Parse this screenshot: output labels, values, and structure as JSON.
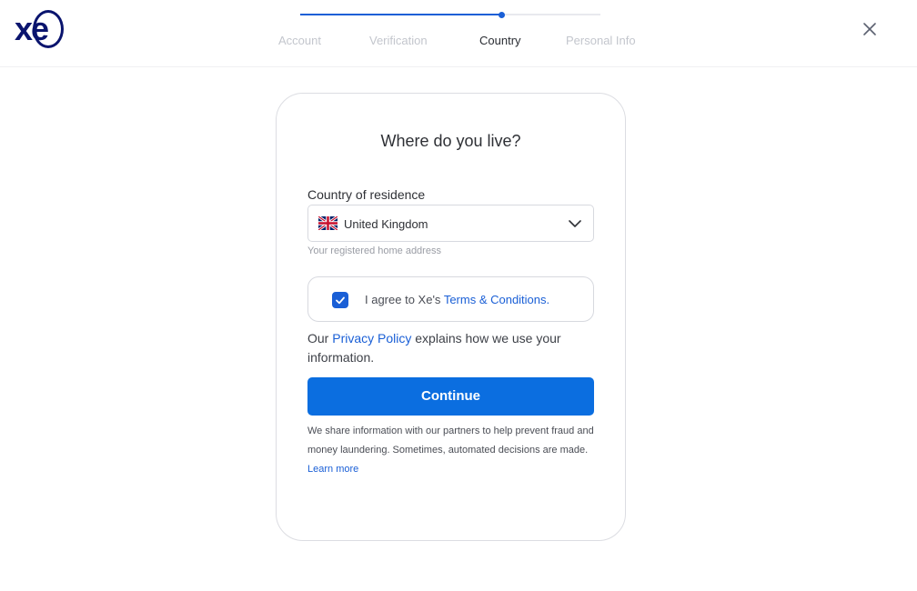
{
  "brand": {
    "logo_text": "xe",
    "accent_color": "#0b6ee0",
    "navy_color": "#0a146e"
  },
  "progress": {
    "fraction_complete": 0.67,
    "steps": [
      {
        "label": "Account",
        "state": "done"
      },
      {
        "label": "Verification",
        "state": "done"
      },
      {
        "label": "Country",
        "state": "active"
      },
      {
        "label": "Personal Info",
        "state": "upcoming"
      }
    ]
  },
  "header": {
    "close_icon": "close-icon"
  },
  "form": {
    "title": "Where do you live?",
    "country_label": "Country of residence",
    "country_value": "United Kingdom",
    "country_flag_icon": "uk-flag-icon",
    "dropdown_icon": "chevron-down-icon",
    "helper_text": "Your registered home address",
    "agree": {
      "checked": true,
      "prefix": "I agree to Xe's ",
      "link": "Terms & Conditions."
    },
    "privacy": {
      "prefix": "Our ",
      "link": "Privacy Policy",
      "suffix": " explains how we use your information."
    },
    "continue_label": "Continue",
    "disclaimer": {
      "text": "We share information with our partners to help prevent fraud and money laundering. Sometimes, automated decisions are made. ",
      "link": "Learn more"
    }
  }
}
